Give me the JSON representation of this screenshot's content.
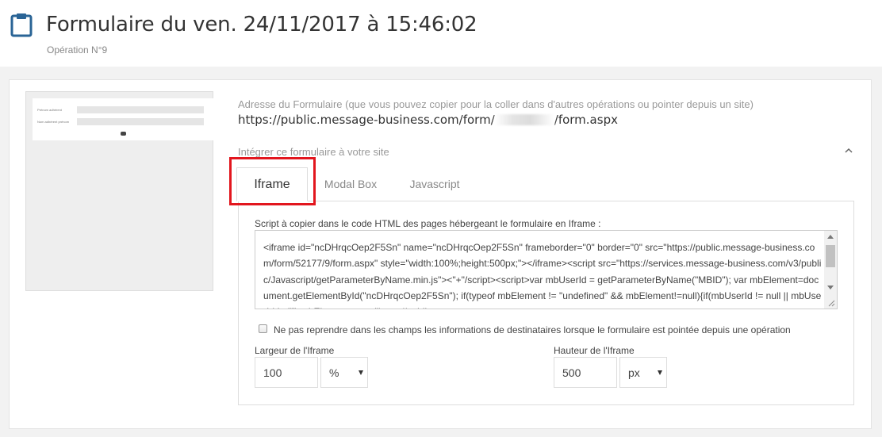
{
  "header": {
    "icon": "clipboard-icon",
    "title": "Formulaire du ven. 24/11/2017 à 15:46:02",
    "subtitle": "Opération N°9"
  },
  "preview": {
    "field1_label": "Prénom adhérent",
    "field2_label": "Nom adhérent prénom"
  },
  "form_address": {
    "label": "Adresse du Formulaire (que vous pouvez copier pour la coller dans d'autres opérations ou pointer depuis un site)",
    "url_prefix": "https://public.message-business.com/form/",
    "url_suffix": "/form.aspx"
  },
  "integrate": {
    "label": "Intégrer ce formulaire à votre site",
    "collapse_icon": "chevron-up-icon"
  },
  "tabs": [
    {
      "label": "Iframe",
      "active": true
    },
    {
      "label": "Modal Box",
      "active": false
    },
    {
      "label": "Javascript",
      "active": false
    }
  ],
  "iframe_tab": {
    "script_label": "Script à copier dans le code HTML des pages hébergeant le formulaire en Iframe :",
    "script_code": "<iframe id=\"ncDHrqcOep2F5Sn\" name=\"ncDHrqcOep2F5Sn\" frameborder=\"0\" border=\"0\" src=\"https://public.message-business.com/form/52177/9/form.aspx\" style=\"width:100%;height:500px;\"></iframe><script src=\"https://services.message-business.com/v3/public/Javascript/getParameterByName.min.js\"><\"+\"/script><script>var mbUserId = getParameterByName(\"MBID\"); var mbElement=document.getElementById(\"ncDHrqcOep2F5Sn\"); if(typeof mbElement != \"undefined\" && mbElement!=null){if(mbUserId != null || mbUserId != \"\") mbElement.src = \"https://public.message-",
    "checkbox_label": "Ne pas reprendre dans les champs les informations de destinataires lorsque le formulaire est pointée depuis une opération",
    "checkbox_checked": false,
    "width_label": "Largeur de l'Iframe",
    "width_value": "100",
    "width_unit": "%",
    "height_label": "Hauteur de l'Iframe",
    "height_value": "500",
    "height_unit": "px"
  },
  "colors": {
    "highlight": "#e2161e",
    "icon_blue": "#2a6496"
  }
}
